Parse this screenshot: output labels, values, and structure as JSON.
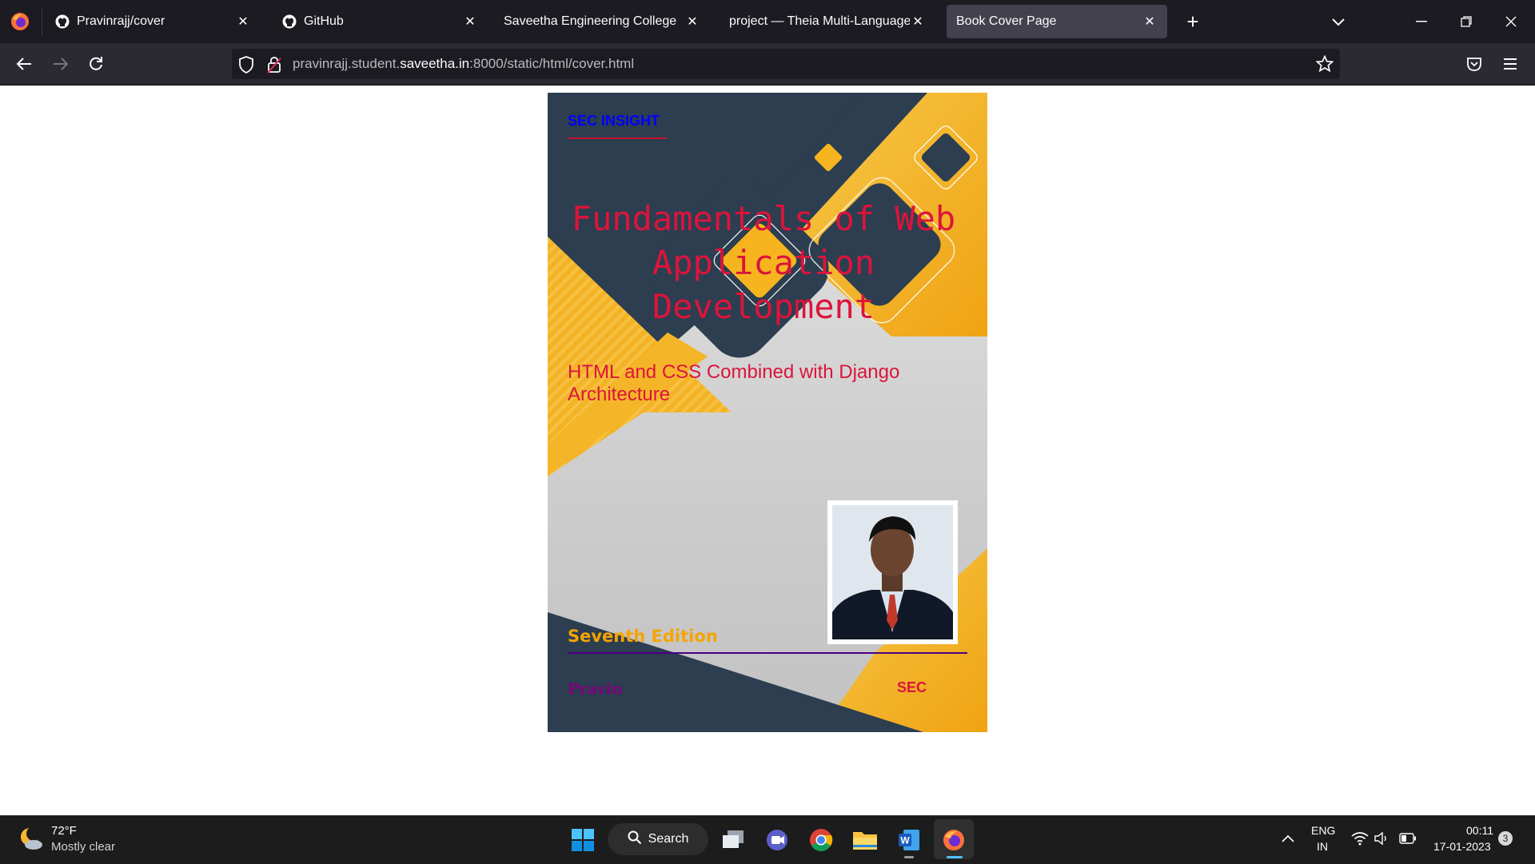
{
  "browser": {
    "tabs": [
      {
        "label": "Pravinrajj/cover",
        "icon": "github-icon",
        "active": false
      },
      {
        "label": "GitHub",
        "icon": "github-icon",
        "active": false
      },
      {
        "label": "Saveetha Engineering College",
        "icon": "",
        "active": false
      },
      {
        "label": "project — Theia Multi-Language Ex",
        "icon": "",
        "active": false
      },
      {
        "label": "Book Cover Page",
        "icon": "",
        "active": true
      }
    ],
    "url_prefix": "pravinrajj.student.",
    "url_host": "saveetha.in",
    "url_suffix": ":8000/static/html/cover.html"
  },
  "cover": {
    "brand": "SEC INSIGHT",
    "title": "Fundamentals of Web Application Development",
    "subtitle": "HTML and CSS Combined with Django Architecture",
    "edition": "Seventh Edition",
    "author": "Pravin",
    "publisher": "SEC",
    "colors": {
      "navy": "#2c3e50",
      "gold": "#f5b21f",
      "title": "#dc143c",
      "brand": "#0000ff",
      "edition": "#f5a400",
      "author": "#800080"
    }
  },
  "taskbar": {
    "weather_temp": "72°F",
    "weather_desc": "Mostly clear",
    "search_label": "Search",
    "lang_1": "ENG",
    "lang_2": "IN",
    "time": "00:11",
    "date": "17-01-2023",
    "notification_count": "3",
    "apps": [
      "windows-start-icon",
      "task-view-icon",
      "teams-chat-icon",
      "chrome-icon",
      "file-explorer-icon",
      "word-icon",
      "firefox-icon"
    ]
  }
}
